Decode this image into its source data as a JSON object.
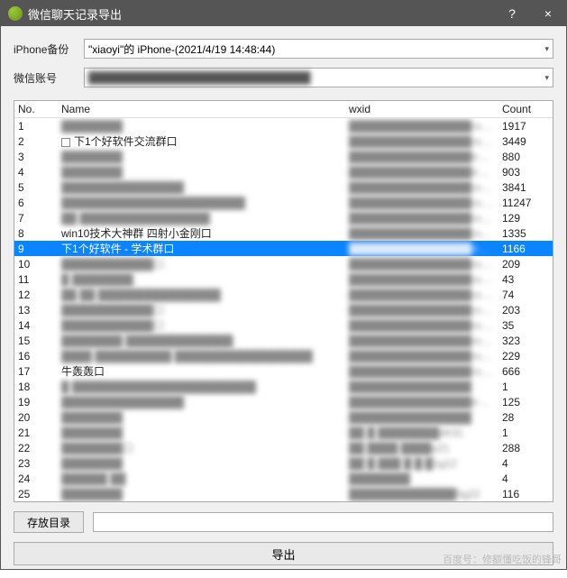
{
  "titlebar": {
    "title": "微信聊天记录导出",
    "help": "?",
    "close": "×"
  },
  "form": {
    "backup_label": "iPhone备份",
    "backup_value": "\"xiaoyi\"的 iPhone-(2021/4/19 14:48:44)",
    "account_label": "微信账号",
    "account_value": "█████████████████████████████"
  },
  "table": {
    "headers": {
      "no": "No.",
      "name": "Name",
      "wxid": "wxid",
      "count": "Count"
    },
    "rows": [
      {
        "no": "1",
        "name": "████████",
        "wxid": "████████████████room",
        "count": "1917",
        "blur": true
      },
      {
        "no": "2",
        "name": "下1个好软件交流群口",
        "wxid": "████████████████room",
        "count": "3449",
        "icon": true
      },
      {
        "no": "3",
        "name": "████████",
        "wxid": "████████████████troom",
        "count": "880",
        "blur": true
      },
      {
        "no": "4",
        "name": "████████",
        "wxid": "████████████████troom",
        "count": "903",
        "blur": true
      },
      {
        "no": "5",
        "name": "████████████████",
        "wxid": "████████████████room",
        "count": "3841",
        "blur": true
      },
      {
        "no": "6",
        "name": "████████████████████████",
        "wxid": "████████████████room",
        "count": "11247",
        "blur": true
      },
      {
        "no": "7",
        "name": "██ █████████████████",
        "wxid": "████████████████room",
        "count": "129",
        "blur": true
      },
      {
        "no": "8",
        "name": "win10技术大神群 四射小金刚口",
        "wxid": "████████████████room",
        "count": "1335"
      },
      {
        "no": "9",
        "name": "下1个好软件 - 学术群口",
        "wxid": "████████████████troom",
        "count": "1166",
        "selected": true
      },
      {
        "no": "10",
        "name": "████████████口",
        "wxid": "████████████████room",
        "count": "209",
        "blur": true
      },
      {
        "no": "11",
        "name": "█ ████████",
        "wxid": "████████████████room",
        "count": "43",
        "blur": true
      },
      {
        "no": "12",
        "name": "██ ██ ████████████████",
        "wxid": "████████████████room",
        "count": "74",
        "blur": true
      },
      {
        "no": "13",
        "name": "████████████口",
        "wxid": "████████████████room",
        "count": "203",
        "blur": true
      },
      {
        "no": "14",
        "name": "████████████口",
        "wxid": "████████████████room",
        "count": "35",
        "blur": true
      },
      {
        "no": "15",
        "name": "████████ ██████████████",
        "wxid": "████████████████room",
        "count": "323",
        "blur": true
      },
      {
        "no": "16",
        "name": "████ ██████████ ██████████████████",
        "wxid": "████████████████room",
        "count": "229",
        "blur": true
      },
      {
        "no": "17",
        "name": "牛轰轰口",
        "wxid": "████████████████room",
        "count": "666"
      },
      {
        "no": "18",
        "name": "█ ████████████████████████",
        "wxid": "████████████████",
        "count": "1",
        "blur": true
      },
      {
        "no": "19",
        "name": "████████████████",
        "wxid": "████████████████troom",
        "count": "125",
        "blur": true
      },
      {
        "no": "20",
        "name": "████████",
        "wxid": "████████████████",
        "count": "28",
        "blur": true
      },
      {
        "no": "21",
        "name": "████████",
        "wxid": "██ █ ████████dh31",
        "count": "1",
        "blur": true
      },
      {
        "no": "22",
        "name": "████████口",
        "wxid": "██  ████ ████p21",
        "count": "288",
        "blur": true
      },
      {
        "no": "23",
        "name": "████████",
        "wxid": "██ █ ███ █ █ █1g12",
        "count": "4",
        "blur": true
      },
      {
        "no": "24",
        "name": "██████ ██",
        "wxid": "████████",
        "count": "4",
        "blur": true
      },
      {
        "no": "25",
        "name": "████████",
        "wxid": "██████████████5g22",
        "count": "116",
        "blur": true
      }
    ]
  },
  "bottom": {
    "save_dir_button": "存放目录",
    "export_button": "导出"
  },
  "watermark": "百度号：修额懂吃饭的锋哥"
}
